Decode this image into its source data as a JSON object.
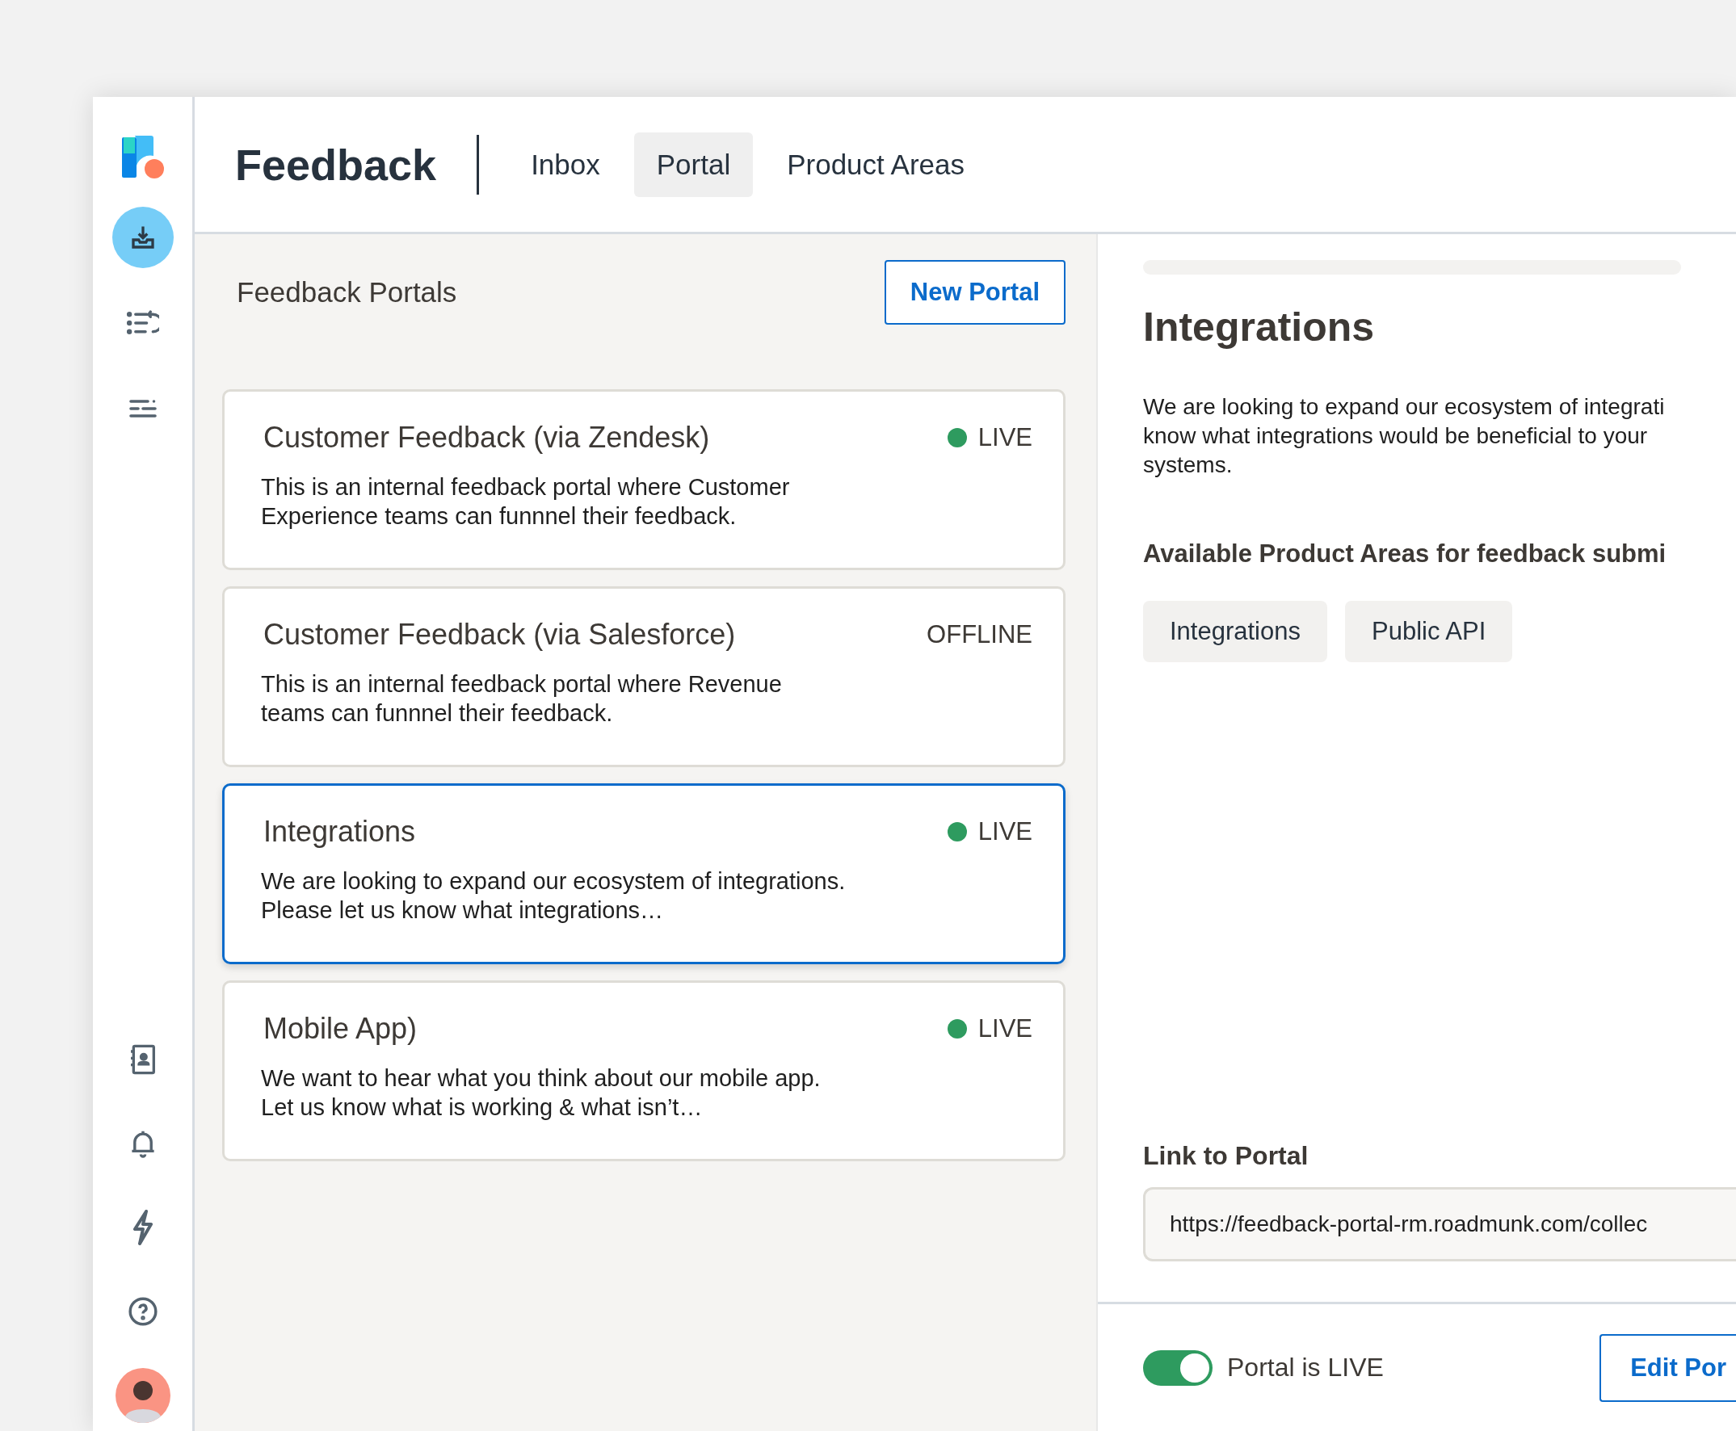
{
  "sidebar": {
    "nav_items": [
      {
        "kind": "inbox",
        "selected": true
      },
      {
        "kind": "list",
        "selected": false
      },
      {
        "kind": "sliders",
        "selected": false
      }
    ],
    "bottom_items": [
      {
        "kind": "contacts"
      },
      {
        "kind": "bell"
      },
      {
        "kind": "bolt"
      },
      {
        "kind": "help"
      },
      {
        "kind": "avatar"
      }
    ]
  },
  "header": {
    "title": "Feedback",
    "tabs": [
      {
        "label": "Inbox",
        "selected": false
      },
      {
        "label": "Portal",
        "selected": true
      },
      {
        "label": "Product Areas",
        "selected": false
      }
    ]
  },
  "portals_panel": {
    "title": "Feedback Portals",
    "new_button": "New Portal",
    "portals": [
      {
        "title": "Customer Feedback (via Zendesk)",
        "description": "This is an internal feedback portal where Customer Experience teams can funnnel their feedback.",
        "status": "LIVE",
        "live": true,
        "selected": false
      },
      {
        "title": "Customer Feedback (via Salesforce)",
        "description": "This is an internal feedback portal where Revenue teams can funnnel their feedback.",
        "status": "OFFLINE",
        "live": false,
        "selected": false
      },
      {
        "title": "Integrations",
        "description": "We are looking to expand our ecosystem of integrations. Please let us know what integrations…",
        "status": "LIVE",
        "live": true,
        "selected": true
      },
      {
        "title": "Mobile App)",
        "description": "We want to hear what you think about our mobile app. Let us know what is working & what isn’t…",
        "status": "LIVE",
        "live": true,
        "selected": false
      }
    ]
  },
  "detail": {
    "title": "Integrations",
    "description_lines": [
      "We are looking to expand our ecosystem of integrati",
      "know what integrations would be beneficial to your",
      "systems."
    ],
    "areas_heading": "Available Product Areas for feedback submi",
    "areas": [
      "Integrations",
      "Public API"
    ],
    "link_label": "Link to Portal",
    "link_value": "https://feedback-portal-rm.roadmunk.com/collec",
    "live_toggle": {
      "on": true,
      "label": "Portal is LIVE"
    },
    "edit_button": "Edit Por"
  }
}
